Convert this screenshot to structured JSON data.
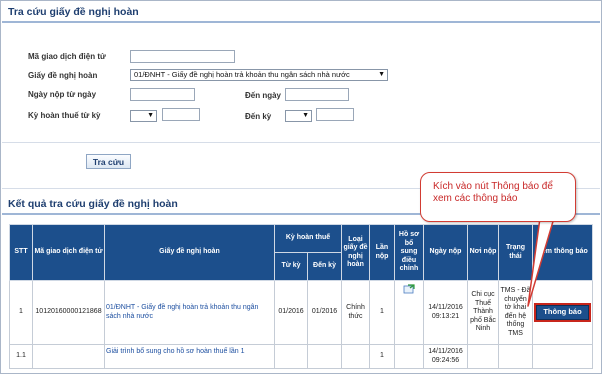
{
  "search_section": {
    "title": "Tra cứu giấy đề nghị hoàn",
    "fields": {
      "transaction_code_label": "Mã giao dịch điện tử",
      "request_type_label": "Giấy đề nghị hoàn",
      "request_type_value": "01/ĐNHT - Giấy đề nghị hoàn trả khoản thu ngân sách nhà nước",
      "from_date_label": "Ngày nộp từ ngày",
      "to_date_label": "Đến ngày",
      "period_from_label": "Kỳ hoàn thuế từ kỳ",
      "period_to_label": "Đến kỳ"
    },
    "search_button": "Tra cứu"
  },
  "results_section": {
    "title": "Kết quả tra cứu giấy đề nghị hoàn",
    "headers": {
      "stt": "STT",
      "code": "Mã giao dịch điện tử",
      "doc": "Giấy đề nghị hoàn",
      "period_group": "Kỳ hoàn thuế",
      "period_from": "Từ kỳ",
      "period_to": "Đến kỳ",
      "doc_type": "Loại giấy đề nghị hoàn",
      "submission_count": "Lần nộp",
      "supplement": "Hồ sơ bổ sung điều chỉnh",
      "submit_date": "Ngày nộp",
      "submit_place": "Nơi nộp",
      "status": "Trạng thái",
      "view_notice": "Xem thông báo"
    },
    "rows": [
      {
        "stt": "1",
        "code": "10120160000121868",
        "doc": "01/ĐNHT - Giấy đề nghị hoàn trả khoản thu ngân sách nhà nước",
        "period_from": "01/2016",
        "period_to": "01/2016",
        "doc_type": "Chính thức",
        "submission_count": "1",
        "submit_date": "14/11/2016 09:13:21",
        "submit_place": "Chi cục Thuế Thành phố Bắc Ninh",
        "status": "TMS - Đã chuyển tờ khai đến hệ thống TMS",
        "notice_button": "Thông báo"
      },
      {
        "stt": "1.1",
        "code": "",
        "doc": "Giải trình bổ sung cho hồ sơ hoàn thuế lần 1",
        "period_from": "",
        "period_to": "",
        "doc_type": "",
        "submission_count": "1",
        "submit_date": "14/11/2016 09:24:56",
        "submit_place": "",
        "status": "",
        "notice_button": ""
      }
    ]
  },
  "callout": {
    "text": "Kích vào nút Thông báo để xem các thông báo"
  },
  "colors": {
    "header_bg": "#1c4f8c",
    "title_color": "#1f3f70",
    "callout_border": "#d23c33",
    "callout_text": "#c82828"
  }
}
